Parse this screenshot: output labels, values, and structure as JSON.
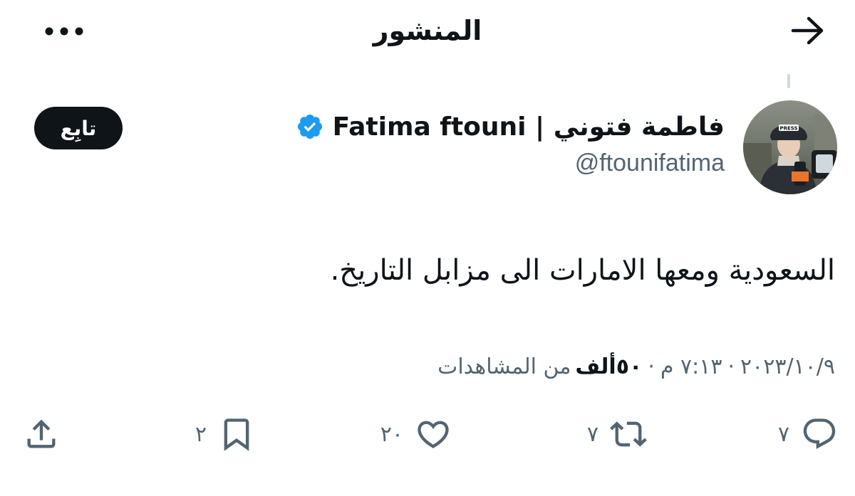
{
  "header": {
    "title": "المنشور",
    "back_icon": "arrow-right-icon",
    "more_icon": "more-horizontal-icon"
  },
  "author": {
    "display_name": "فاطمة فتوني | Fatima ftouni",
    "handle": "@ftounifatima",
    "verified": true,
    "verified_color": "#1d9bf0",
    "avatar_badge": "PRESS"
  },
  "follow_button": {
    "label": "تابِع",
    "background": "#0f1419",
    "color": "#ffffff"
  },
  "tweet": {
    "text": "السعودية ومعها الامارات الى مزابل التاريخ."
  },
  "meta": {
    "date": "٢٠٢٣/١٠/٩",
    "separator": "·",
    "time": "٧:١٣ م",
    "views_count": "٥٠ألف",
    "views_label": "من المشاهدات"
  },
  "actions": {
    "reply": {
      "icon": "reply-icon",
      "count": "٧"
    },
    "retweet": {
      "icon": "retweet-icon",
      "count": "٧"
    },
    "like": {
      "icon": "heart-icon",
      "count": "٢٠"
    },
    "bookmark": {
      "icon": "bookmark-icon",
      "count": "٢"
    },
    "share": {
      "icon": "share-icon"
    }
  },
  "colors": {
    "text_primary": "#0f1419",
    "text_secondary": "#536471",
    "accent": "#1d9bf0"
  }
}
